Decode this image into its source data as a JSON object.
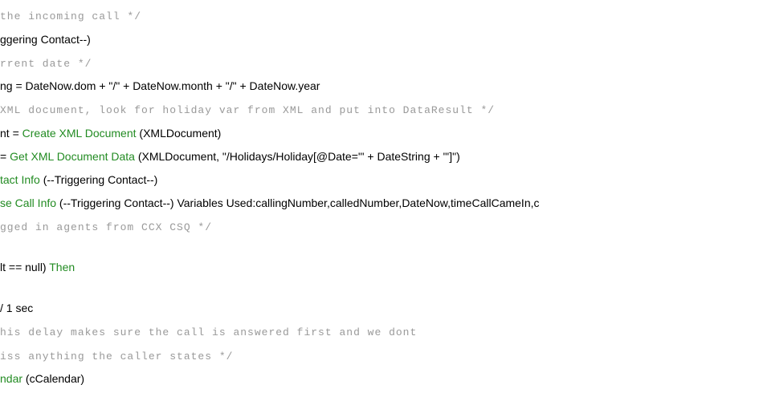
{
  "lines": [
    {
      "type": "comment",
      "text": " the incoming call */"
    },
    {
      "type": "code-arial",
      "segments": [
        {
          "cls": "code",
          "text": "ggering Contact--)"
        }
      ]
    },
    {
      "type": "comment",
      "text": "rrent date */"
    },
    {
      "type": "code-arial",
      "segments": [
        {
          "cls": "code",
          "text": "ng = DateNow.dom + \"/\" + DateNow.month + \"/\" + DateNow.year"
        }
      ]
    },
    {
      "type": "comment",
      "text": " XML document, look for holiday var from XML and put into DataResult */"
    },
    {
      "type": "code-arial",
      "segments": [
        {
          "cls": "code",
          "text": "nt = "
        },
        {
          "cls": "keyword",
          "text": "Create XML Document"
        },
        {
          "cls": "code",
          "text": " (XMLDocument)"
        }
      ]
    },
    {
      "type": "code-arial",
      "segments": [
        {
          "cls": "code",
          "text": " = "
        },
        {
          "cls": "keyword",
          "text": "Get XML Document Data"
        },
        {
          "cls": "code",
          "text": " (XMLDocument, \"/Holidays/Holiday[@Date='\" + DateString + \"']\")"
        }
      ]
    },
    {
      "type": "code-arial",
      "segments": [
        {
          "cls": "keyword",
          "text": "tact Info"
        },
        {
          "cls": "code",
          "text": " (--Triggering Contact--)"
        }
      ]
    },
    {
      "type": "code-arial",
      "segments": [
        {
          "cls": "keyword",
          "text": "se Call Info"
        },
        {
          "cls": "code",
          "text": " (--Triggering Contact--) Variables Used:callingNumber,calledNumber,DateNow,timeCallCameIn,c"
        }
      ]
    },
    {
      "type": "comment",
      "text": "gged in agents from CCX CSQ */"
    },
    {
      "type": "spacer"
    },
    {
      "type": "code-arial",
      "segments": [
        {
          "cls": "code",
          "text": "lt == null) "
        },
        {
          "cls": "keyword",
          "text": "Then"
        }
      ]
    },
    {
      "type": "spacer"
    },
    {
      "type": "code-arial",
      "segments": [
        {
          "cls": "code",
          "text": "/ 1 sec"
        }
      ]
    },
    {
      "type": "comment",
      "text": "his delay makes sure the call is answered first and we dont"
    },
    {
      "type": "comment",
      "text": "iss anything the caller states */"
    },
    {
      "type": "code-arial",
      "segments": [
        {
          "cls": "keyword",
          "text": "ndar"
        },
        {
          "cls": "code",
          "text": " (cCalendar)"
        }
      ]
    }
  ]
}
